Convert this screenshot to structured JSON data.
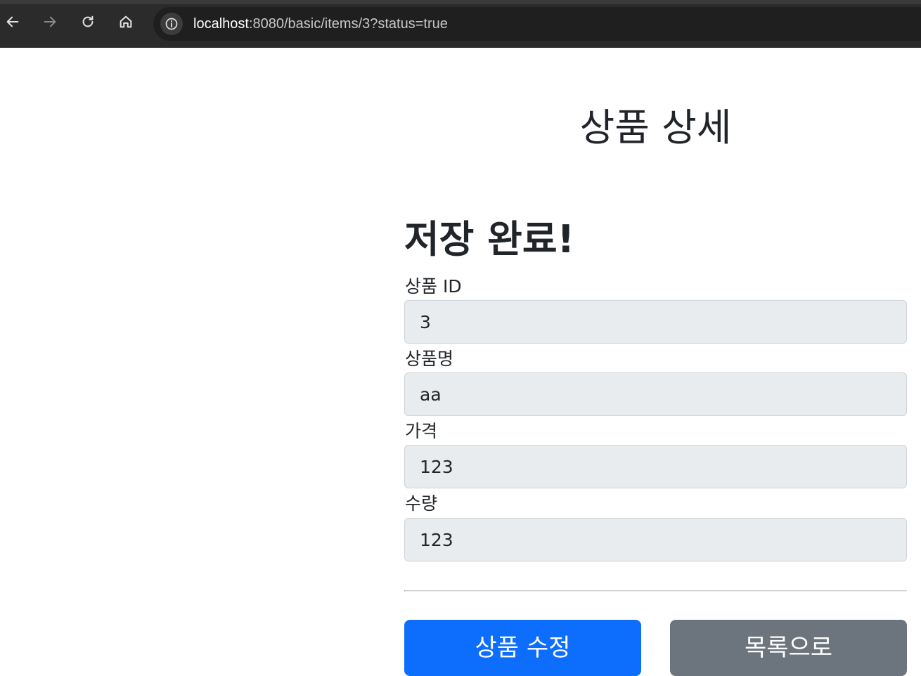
{
  "browser": {
    "url_host": "localhost",
    "url_rest": ":8080/basic/items/3?status=true"
  },
  "page": {
    "title": "상품 상세",
    "status_message": "저장 완료!"
  },
  "form": {
    "fields": [
      {
        "label": "상품 ID",
        "value": "3"
      },
      {
        "label": "상품명",
        "value": "aa"
      },
      {
        "label": "가격",
        "value": "123"
      },
      {
        "label": "수량",
        "value": "123"
      }
    ]
  },
  "actions": {
    "edit_label": "상품 수정",
    "list_label": "목록으로"
  },
  "colors": {
    "primary": "#0d6efd",
    "secondary": "#6c757d",
    "readonly_input": "#e9ecef"
  }
}
